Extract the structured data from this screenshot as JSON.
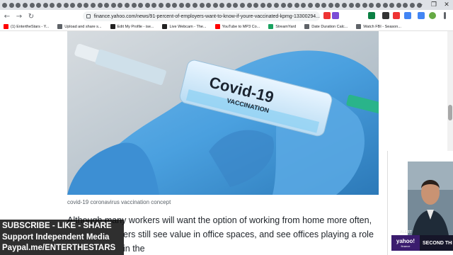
{
  "browser": {
    "url": "finance.yahoo.com/news/91-percent-of-employers-want-to-know-if-youre-vaccinated-kpmg-13300294...",
    "tab_count": 62
  },
  "bookmarks": [
    {
      "label": "(1) EntertheStars - Y...",
      "icon_color": "#ff0000"
    },
    {
      "label": "Upload and share s...",
      "icon_color": "#5f6368"
    },
    {
      "label": "Edit My Profile - ise...",
      "icon_color": "#222222"
    },
    {
      "label": "Live Webcam - The...",
      "icon_color": "#222222"
    },
    {
      "label": "YouTube to MP3 Co...",
      "icon_color": "#ff0000"
    },
    {
      "label": "StreamYard",
      "icon_color": "#1aa260"
    },
    {
      "label": "Date Duration Calc...",
      "icon_color": "#5f6368"
    },
    {
      "label": "Watch FBI - Season...",
      "icon_color": "#5f6368"
    }
  ],
  "article": {
    "image_text_main": "Covid-19",
    "image_text_sub": "VACCINATION",
    "caption": "covid-19 coronavirus vaccination concept",
    "paragraph_line1": "Although many workers will want the option of working from home more often,",
    "paragraph_line2": "ers still see value in office spaces, and see offices playing a role in the"
  },
  "overlay": {
    "line1": "SUBSCRIBE - LIKE - SHARE",
    "line2": "Support Independent Media",
    "line3": "Paypal.me/ENTERTHESTARS"
  },
  "video": {
    "alert": "ALERT",
    "brand": "yahoo!",
    "brand_sub": "finance",
    "ticker": "SECOND THREAD"
  }
}
